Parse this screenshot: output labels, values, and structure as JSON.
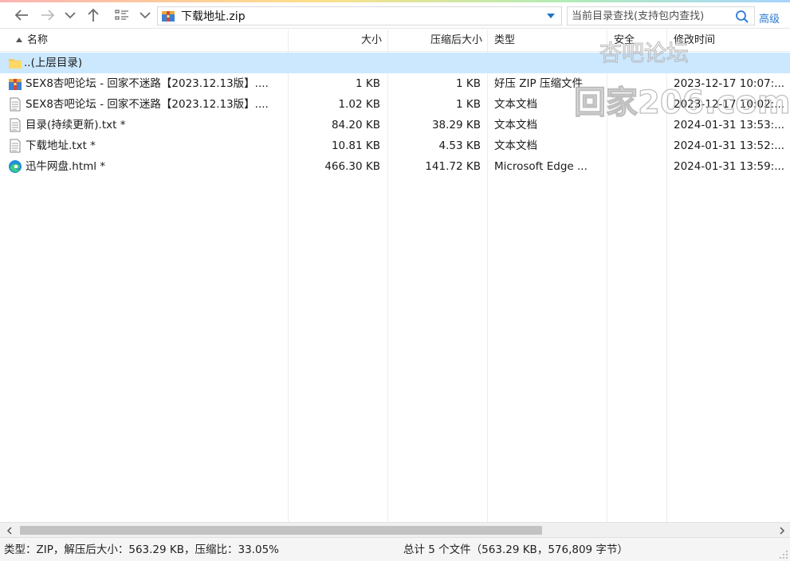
{
  "nav": {
    "back_icon": "back-arrow-icon",
    "forward_icon": "forward-arrow-icon",
    "history_icon": "chevron-down-icon",
    "up_icon": "up-arrow-icon",
    "view_icon": "list-view-icon"
  },
  "address": {
    "path": "下载地址.zip",
    "icon": "zip-archive-icon"
  },
  "search": {
    "placeholder": "当前目录查找(支持包内查找)",
    "advanced_label": "高级"
  },
  "columns": {
    "name": "名称",
    "size": "大小",
    "packed": "压缩后大小",
    "type": "类型",
    "security": "安全",
    "modified": "修改时间"
  },
  "files": [
    {
      "icon": "folder-icon",
      "name": "..(上层目录)",
      "size": "",
      "packed": "",
      "type": "",
      "modified": "",
      "selected": true
    },
    {
      "icon": "zip-archive-icon",
      "name": "SEX8杏吧论坛 - 回家不迷路【2023.12.13版】....",
      "size": "1 KB",
      "packed": "1 KB",
      "type": "好压 ZIP 压缩文件",
      "modified": "2023-12-17 10:07:...",
      "selected": false
    },
    {
      "icon": "text-file-icon",
      "name": "SEX8杏吧论坛 - 回家不迷路【2023.12.13版】....",
      "size": "1.02 KB",
      "packed": "1 KB",
      "type": "文本文档",
      "modified": "2023-12-17 10:02:...",
      "selected": false
    },
    {
      "icon": "text-file-icon",
      "name": "目录(持续更新).txt *",
      "size": "84.20 KB",
      "packed": "38.29 KB",
      "type": "文本文档",
      "modified": "2024-01-31 13:53:...",
      "selected": false
    },
    {
      "icon": "text-file-icon",
      "name": "下载地址.txt *",
      "size": "10.81 KB",
      "packed": "4.53 KB",
      "type": "文本文档",
      "modified": "2024-01-31 13:52:...",
      "selected": false
    },
    {
      "icon": "edge-browser-icon",
      "name": "迅牛网盘.html *",
      "size": "466.30 KB",
      "packed": "141.72 KB",
      "type": "Microsoft Edge ...",
      "modified": "2024-01-31 13:59:...",
      "selected": false
    }
  ],
  "watermark": {
    "line1": "杏吧论坛",
    "line2": "回家206.com"
  },
  "status": {
    "left": "类型：ZIP，解压后大小：563.29 KB，压缩比：33.05%",
    "middle": "总计 5 个文件（563.29 KB，576,809 字节）"
  },
  "colors": {
    "selected_row": "#cce8ff",
    "accent_blue": "#2d7cd6",
    "status_bg": "#f5f5f5"
  }
}
